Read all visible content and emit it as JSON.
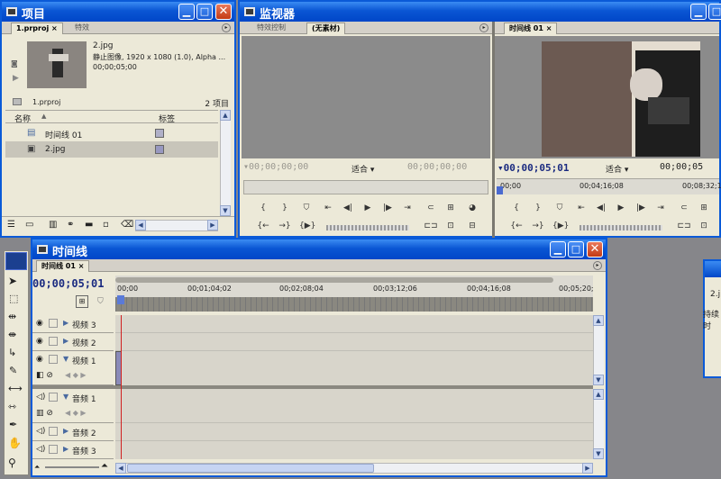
{
  "project": {
    "title": "项目",
    "tabs": [
      "1.prproj",
      "特效"
    ],
    "clip_name": "2.jpg",
    "clip_type": "静止图像, 1920 x 1080 (1.0), Alpha ...",
    "clip_duration": "00;00;05;00",
    "project_file": "1.prproj",
    "item_count": "2 项目",
    "col_name": "名称",
    "col_label": "标签",
    "items": [
      {
        "name": "时间线 01",
        "icon": "sequence-icon",
        "label_color": "#b0b0c8"
      },
      {
        "name": "2.jpg",
        "icon": "image-icon",
        "label_color": "#9898c0"
      }
    ]
  },
  "monitor": {
    "title": "监视器",
    "source_tabs": [
      "特效控制",
      "(无素材)"
    ],
    "source_timecode_left": "00;00;00;00",
    "source_fit": "适合",
    "source_timecode_right": "00;00;00;00",
    "program_tab": "时间线 01",
    "program_timecode": "00;00;05;01",
    "program_fit": "适合",
    "program_timecode_right": "00;00;05",
    "ruler": [
      "00;00",
      "00;04;16;08",
      "00;08;32;1"
    ]
  },
  "timeline": {
    "title": "时间线",
    "tab": "时间线 01",
    "timecode": "00;00;05;01",
    "ruler": [
      "00;00",
      "00;01;04;02",
      "00;02;08;04",
      "00;03;12;06",
      "00;04;16;08",
      "00;05;20;"
    ],
    "video_tracks": [
      "视频 3",
      "视频 2",
      "视频 1"
    ],
    "audio_tracks": [
      "音频 1",
      "音频 2",
      "音频 3"
    ]
  },
  "partial_window": {
    "line1": "2.j",
    "line2": "持续时"
  }
}
